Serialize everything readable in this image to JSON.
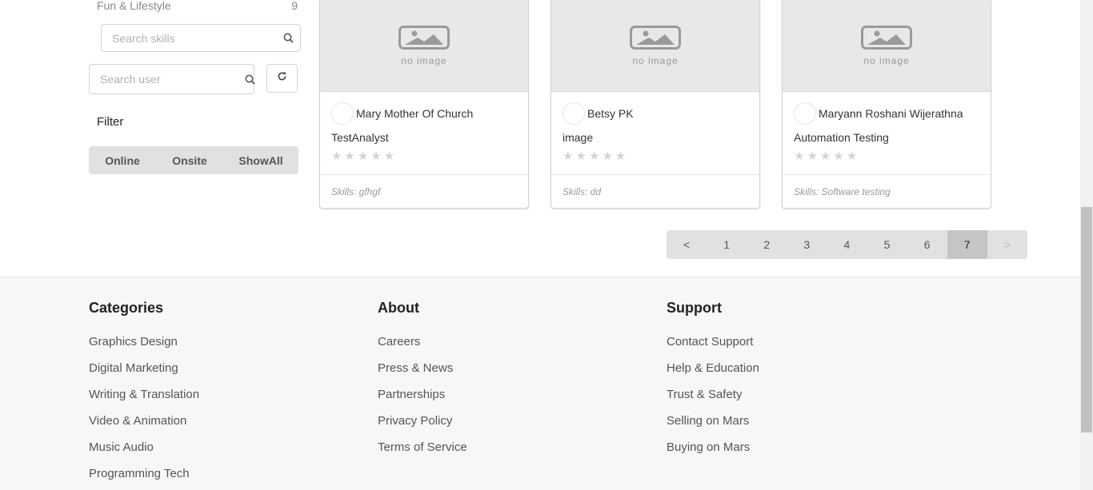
{
  "sidebar": {
    "category": {
      "label": "Fun & Lifestyle",
      "count": "9"
    },
    "skill_search_placeholder": "Search skills",
    "user_search_placeholder": "Search user",
    "filter_title": "Filter",
    "filter_options": [
      "Online",
      "Onsite",
      "ShowAll"
    ]
  },
  "cards": [
    {
      "no_image_text": "no image",
      "user_name": "Mary Mother Of Church",
      "role": "TestAnalyst",
      "rating": 0,
      "skills": "Skills: gfhgf"
    },
    {
      "no_image_text": "no image",
      "user_name": "Betsy PK",
      "role": "image",
      "rating": 0,
      "skills": "Skills: dd"
    },
    {
      "no_image_text": "no image",
      "user_name": "Maryann Roshani Wijerathna",
      "role": "Automation Testing",
      "rating": 0,
      "skills": "Skills: Software testing"
    }
  ],
  "pagination": {
    "prev": "<",
    "pages": [
      "1",
      "2",
      "3",
      "4",
      "5",
      "6",
      "7"
    ],
    "active_page": "7",
    "next": ">"
  },
  "footer": {
    "categories": {
      "title": "Categories",
      "links": [
        "Graphics Design",
        "Digital Marketing",
        "Writing & Translation",
        "Video & Animation",
        "Music Audio",
        "Programming Tech"
      ]
    },
    "about": {
      "title": "About",
      "links": [
        "Careers",
        "Press & News",
        "Partnerships",
        "Privacy Policy",
        "Terms of Service"
      ]
    },
    "support": {
      "title": "Support",
      "links": [
        "Contact Support",
        "Help & Education",
        "Trust & Safety",
        "Selling on Mars",
        "Buying on Mars"
      ]
    }
  },
  "icons": {
    "search": "search-icon",
    "refresh": "refresh-icon",
    "no_image": "no-image-icon",
    "star": "star-icon"
  },
  "colors": {
    "segment_bg": "#e0e1e2",
    "active_page_bg": "#c4c5c6",
    "footer_bg": "#f7f7f7",
    "star_empty": "#d4d4d4"
  }
}
